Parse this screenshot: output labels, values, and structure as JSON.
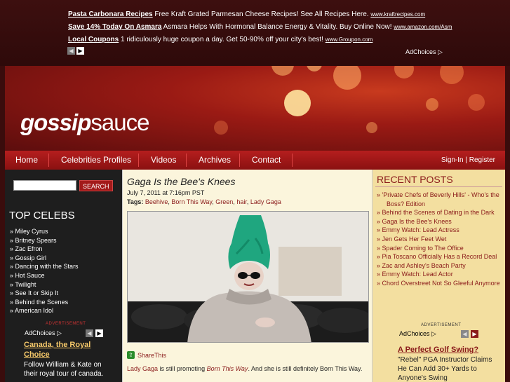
{
  "top_ads": [
    {
      "title": "Pasta Carbonara Recipes",
      "text": "Free Kraft Grated Parmesan Cheese Recipes! See All Recipes Here.",
      "url": "www.kraftrecipes.com"
    },
    {
      "title": "Save 14% Today On Asmara",
      "text": "Asmara Helps With Hormonal Balance Energy & Vitality. Buy Online Now!",
      "url": "www.amazon.com/Asm"
    },
    {
      "title": "Local Coupons",
      "text": "1 ridiculously huge coupon a day. Get 50-90% off your city's best!",
      "url": "www.Groupon.com"
    }
  ],
  "adchoices_label": "AdChoices",
  "site": {
    "logo_bold": "gossip",
    "logo_rest": "sauce"
  },
  "nav": {
    "items": [
      "Home",
      "Celebrities Profiles",
      "Videos",
      "Archives",
      "Contact"
    ],
    "signin": "Sign-In | Register"
  },
  "left": {
    "search_placeholder": "",
    "search_button": "SEARCH",
    "celebs_title": "TOP CELEBS",
    "celebs": [
      "Miley Cyrus",
      "Britney Spears",
      "Zac Efron",
      "Gossip Girl",
      "Dancing with the Stars",
      "Hot Sauce",
      "Twilight",
      "See It or Skip It",
      "Behind the Scenes",
      "American Idol"
    ],
    "advertisement_label": "ADVERTISEMENT",
    "ad_title": "Canada, the Royal Choice",
    "ad_body": "Follow William & Kate on their royal tour of canada."
  },
  "post": {
    "title": "Gaga Is the Bee's Knees",
    "date": "July 7, 2011 at 7:16pm PST",
    "tags_label": "Tags:",
    "tags": [
      "Beehive",
      "Born This Way",
      "Green",
      "hair",
      "Lady Gaga"
    ],
    "share_label": "ShareThis",
    "text_link": "Lady Gaga",
    "text_mid": " is still promoting ",
    "text_italic": "Born This Way",
    "text_end": ". And she is still definitely Born This Way."
  },
  "right": {
    "recent_title": "RECENT POSTS",
    "recent": [
      "'Private Chefs of Beverly Hills' - Who's the Boss? Edition",
      "Behind the Scenes of Dating in the Dark",
      "Gaga Is the Bee's Knees",
      "Emmy Watch: Lead Actress",
      "Jen Gets Her Feet Wet",
      "Spader Coming to The Office",
      "Pia Toscano Officially Has a Record Deal",
      "Zac and Ashley's Beach Party",
      "Emmy Watch: Lead Actor",
      "Chord Overstreet Not So Gleeful Anymore"
    ],
    "advertisement_label": "ADVERTISEMENT",
    "ad_title": "A Perfect Golf Swing?",
    "ad_body": "\"Rebel\" PGA Instructor Claims He Can Add 30+ Yards to Anyone's Swing"
  }
}
